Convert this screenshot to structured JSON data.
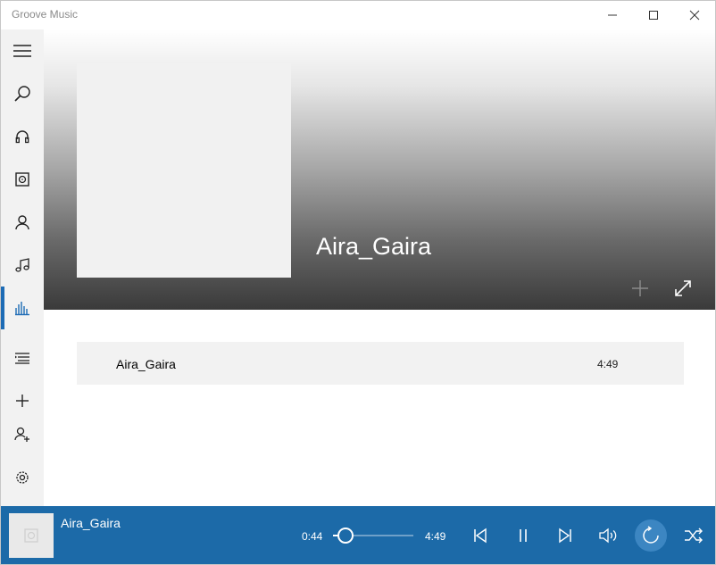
{
  "window": {
    "title": "Groove Music"
  },
  "sidebar": {
    "items": [
      {
        "icon": "hamburger-menu-icon"
      },
      {
        "icon": "search-icon"
      },
      {
        "icon": "headphones-icon"
      },
      {
        "icon": "album-icon"
      },
      {
        "icon": "artist-icon"
      },
      {
        "icon": "music-note-icon"
      },
      {
        "icon": "now-playing-icon",
        "active": true
      },
      {
        "icon": "playlists-icon"
      },
      {
        "icon": "plus-icon"
      },
      {
        "icon": "add-user-icon"
      },
      {
        "icon": "gear-icon"
      }
    ]
  },
  "hero": {
    "title": "Aira_Gaira"
  },
  "tracks": [
    {
      "title": "Aira_Gaira",
      "duration": "4:49"
    }
  ],
  "player": {
    "track_title": "Aira_Gaira",
    "current_time": "0:44",
    "total_time": "4:49",
    "progress": 0.152,
    "repeat_active": true
  },
  "colors": {
    "accent": "#1c6aa8",
    "active_indicator": "#1d6bb5",
    "sidebar_bg": "#f2f2f2",
    "track_row_bg": "#f2f2f2"
  }
}
